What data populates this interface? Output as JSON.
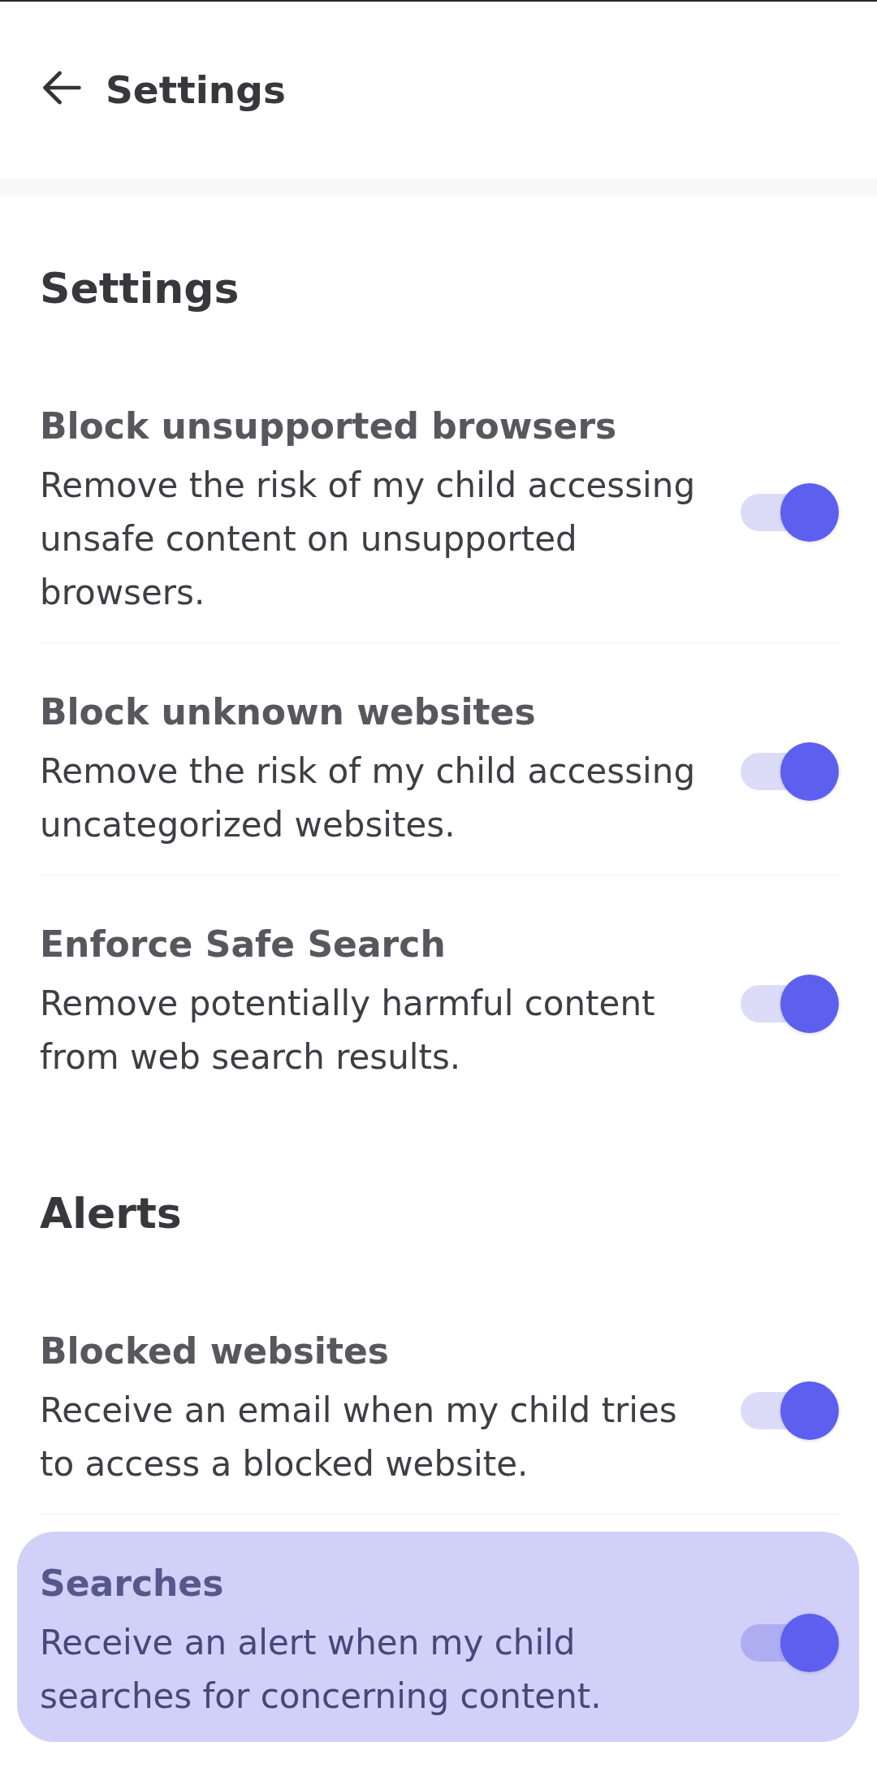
{
  "header": {
    "title": "Settings"
  },
  "sections": [
    {
      "heading": "Settings",
      "items": [
        {
          "title": "Block unsupported browsers",
          "description": "Remove the risk of my child accessing unsafe content on unsupported browsers.",
          "on": true,
          "highlighted": false
        },
        {
          "title": "Block unknown websites",
          "description": "Remove the risk of my child accessing uncategorized websites.",
          "on": true,
          "highlighted": false
        },
        {
          "title": "Enforce Safe Search",
          "description": "Remove potentially harmful content from web search results.",
          "on": true,
          "highlighted": false
        }
      ]
    },
    {
      "heading": "Alerts",
      "items": [
        {
          "title": "Blocked websites",
          "description": "Receive an email when my child tries to access a blocked website.",
          "on": true,
          "highlighted": false
        },
        {
          "title": "Searches",
          "description": "Receive an alert when my child searches for concerning content.",
          "on": true,
          "highlighted": true
        }
      ]
    }
  ]
}
